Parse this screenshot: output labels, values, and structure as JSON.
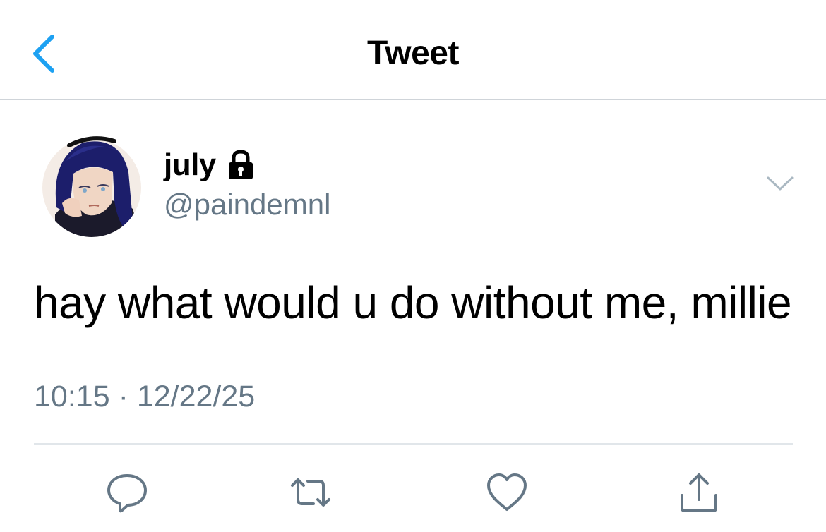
{
  "header": {
    "title": "Tweet"
  },
  "user": {
    "display_name": "july",
    "handle": "@paindemnl",
    "protected": true
  },
  "tweet": {
    "text": "hay what would u do without me, millie",
    "time": "10:15",
    "separator": "·",
    "date": "12/22/25"
  },
  "icons": {
    "back": "chevron-left-icon",
    "lock": "lock-icon",
    "caret": "chevron-down-icon",
    "reply": "speech-bubble-icon",
    "retweet": "retweet-icon",
    "like": "heart-icon",
    "share": "share-icon"
  },
  "colors": {
    "accent": "#1da1f2",
    "secondary_text": "#657786",
    "divider": "#e1e6ea",
    "icon": "#657786"
  }
}
